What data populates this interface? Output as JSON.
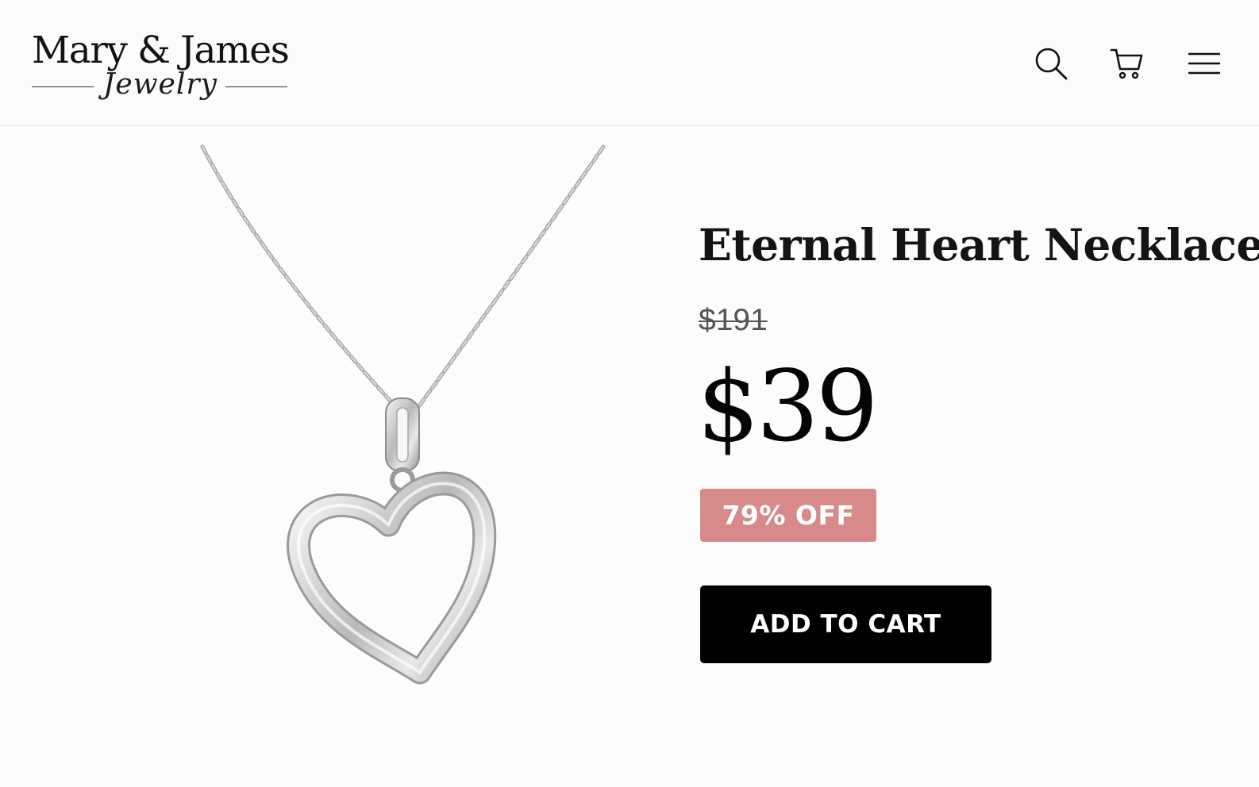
{
  "brand": {
    "name": "Mary & James",
    "subtitle": "Jewelry"
  },
  "header": {
    "icons": {
      "search": "search-icon",
      "cart": "cart-icon",
      "menu": "menu-icon"
    }
  },
  "product": {
    "title": "Eternal Heart Necklace",
    "original_price": "$191",
    "sale_price": "$39",
    "discount_label": "79% OFF",
    "add_to_cart_label": "ADD TO CART"
  },
  "colors": {
    "badge": "#d88a8a",
    "button": "#000000",
    "metal": "#c9c9c9"
  }
}
